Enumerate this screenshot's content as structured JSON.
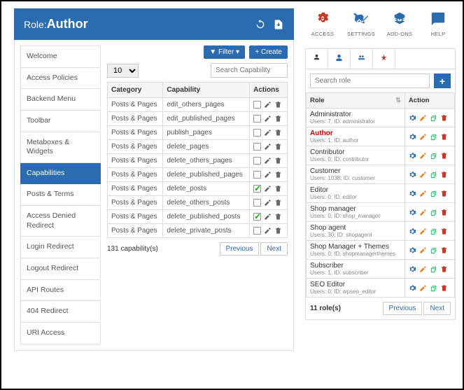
{
  "header": {
    "prefix": "Role: ",
    "name": "Author"
  },
  "sidenav": [
    {
      "label": "Welcome"
    },
    {
      "label": "Access Policies"
    },
    {
      "label": "Backend Menu"
    },
    {
      "label": "Toolbar"
    },
    {
      "label": "Metaboxes & Widgets"
    },
    {
      "label": "Capabilities",
      "active": true
    },
    {
      "label": "Posts & Terms"
    },
    {
      "label": "Access Denied Redirect"
    },
    {
      "label": "Login Redirect"
    },
    {
      "label": "Logout Redirect"
    },
    {
      "label": "API Routes"
    },
    {
      "label": "404 Redirect"
    },
    {
      "label": "URI Access"
    }
  ],
  "toolbar": {
    "filter": "Filter",
    "create": "+ Create",
    "pagesize": "10",
    "search_placeholder": "Search Capability"
  },
  "cols": {
    "category": "Category",
    "capability": "Capability",
    "actions": "Actions"
  },
  "caps": [
    {
      "cat": "Posts & Pages",
      "cap": "edit_others_pages",
      "on": false
    },
    {
      "cat": "Posts & Pages",
      "cap": "edit_published_pages",
      "on": false
    },
    {
      "cat": "Posts & Pages",
      "cap": "publish_pages",
      "on": false
    },
    {
      "cat": "Posts & Pages",
      "cap": "delete_pages",
      "on": false
    },
    {
      "cat": "Posts & Pages",
      "cap": "delete_others_pages",
      "on": false
    },
    {
      "cat": "Posts & Pages",
      "cap": "delete_published_pages",
      "on": false
    },
    {
      "cat": "Posts & Pages",
      "cap": "delete_posts",
      "on": true
    },
    {
      "cat": "Posts & Pages",
      "cap": "delete_others_posts",
      "on": false
    },
    {
      "cat": "Posts & Pages",
      "cap": "delete_published_posts",
      "on": true
    },
    {
      "cat": "Posts & Pages",
      "cap": "delete_private_posts",
      "on": false
    }
  ],
  "foot": {
    "count": "131 capability(s)",
    "prev": "Previous",
    "next": "Next"
  },
  "quick": [
    {
      "label": "ACCESS",
      "color": "#c0392b"
    },
    {
      "label": "SETTINGS",
      "color": "#2b6cb0"
    },
    {
      "label": "ADD-ONS",
      "color": "#2b6cb0"
    },
    {
      "label": "HELP",
      "color": "#2b6cb0"
    }
  ],
  "role_search": "Search role",
  "rcols": {
    "role": "Role",
    "action": "Action"
  },
  "roles": [
    {
      "name": "Administrator",
      "sub": "Users: 7; ID: administrator"
    },
    {
      "name": "Author",
      "sub": "Users: 1; ID: author",
      "red": true
    },
    {
      "name": "Contributor",
      "sub": "Users: 0; ID: contributor"
    },
    {
      "name": "Customer",
      "sub": "Users: 1038; ID: customer"
    },
    {
      "name": "Editor",
      "sub": "Users: 0; ID: editor"
    },
    {
      "name": "Shop manager",
      "sub": "Users: 0; ID: shop_manager"
    },
    {
      "name": "Shop agent",
      "sub": "Users: 30; ID: shopagent"
    },
    {
      "name": "Shop Manager + Themes",
      "sub": "Users: 0; ID: shopmanagerthemes"
    },
    {
      "name": "Subscriber",
      "sub": "Users: 1; ID: subscriber"
    },
    {
      "name": "SEO Editor",
      "sub": "Users: 0; ID: wpseo_editor"
    }
  ],
  "rfoot": {
    "count": "11 role(s)",
    "prev": "Previous",
    "next": "Next"
  }
}
